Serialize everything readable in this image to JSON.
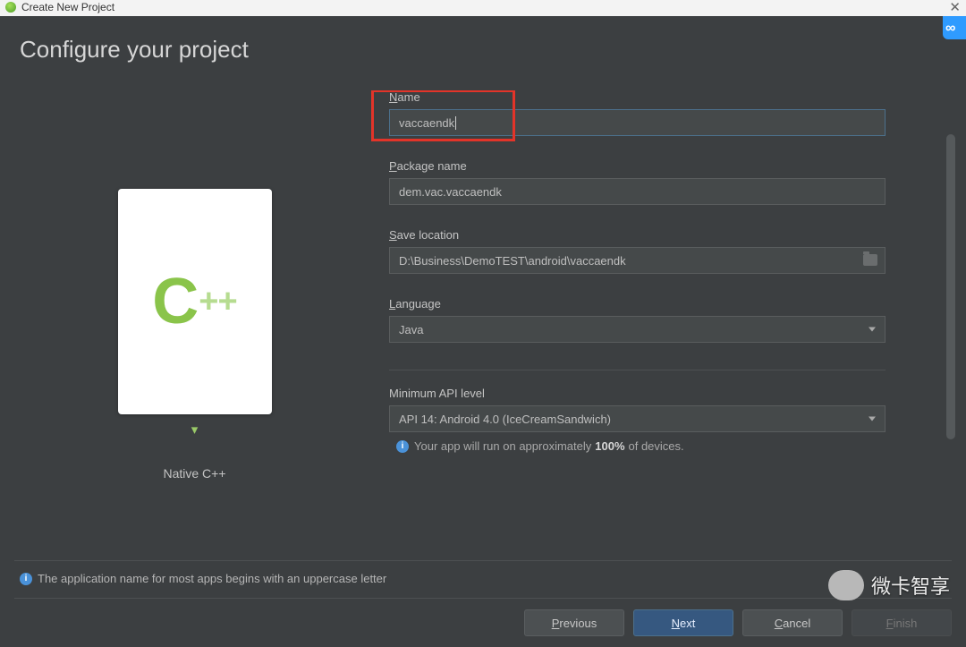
{
  "window": {
    "title": "Create New Project"
  },
  "header": {
    "heading": "Configure your project"
  },
  "thumb": {
    "caption": "Native C++",
    "logo_text": "C",
    "logo_plus": "++",
    "follow": "▾"
  },
  "form": {
    "name_label_u": "N",
    "name_label_rest": "ame",
    "name_value": "vaccaendk",
    "pkg_label_u": "P",
    "pkg_label_rest": "ackage name",
    "pkg_value": "dem.vac.vaccaendk",
    "save_label_u": "S",
    "save_label_rest": "ave location",
    "save_value": "D:\\Business\\DemoTEST\\android\\vaccaendk",
    "lang_label_u": "L",
    "lang_label_rest": "anguage",
    "lang_value": "Java",
    "api_section": "Minimum API level",
    "api_value": "API 14: Android 4.0 (IceCreamSandwich)",
    "api_note_pre": "Your app will run on approximately",
    "api_note_pct": "100%",
    "api_note_post": "of devices."
  },
  "hint": "The application name for most apps begins with an uppercase letter",
  "buttons": {
    "prev_u": "P",
    "prev_rest": "revious",
    "next_u": "N",
    "next_rest": "ext",
    "cancel_u": "C",
    "cancel_rest": "ancel",
    "finish_u": "F",
    "finish_rest": "inish"
  },
  "watermark": "微卡智享"
}
